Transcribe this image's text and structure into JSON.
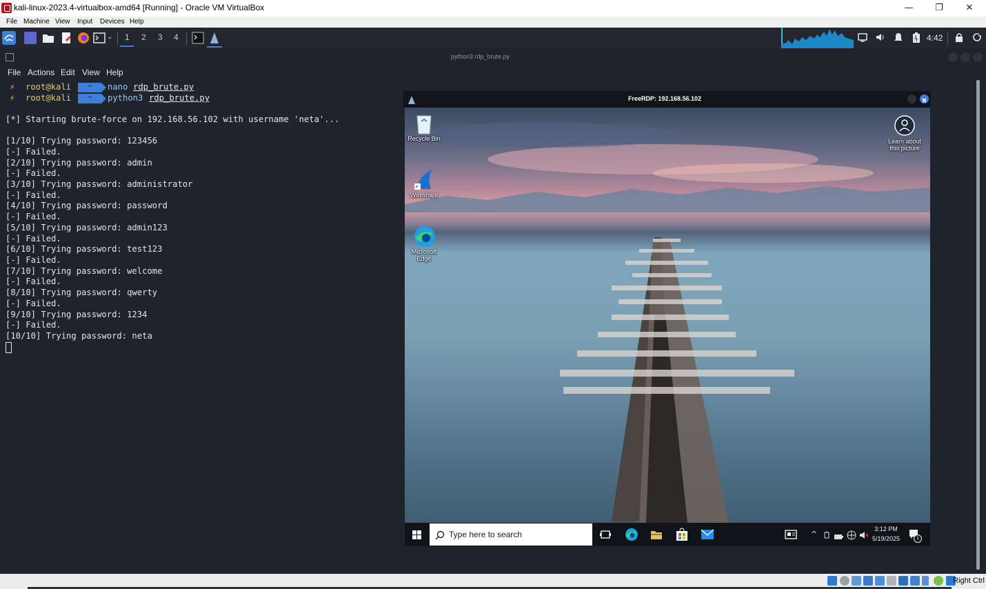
{
  "host_window": {
    "title": "kali-linux-2023.4-virtualbox-amd64 [Running] - Oracle VM VirtualBox",
    "menu": [
      "File",
      "Machine",
      "View",
      "Input",
      "Devices",
      "Help"
    ],
    "controls": {
      "minimize": "—",
      "restore": "❐",
      "close": "✕"
    }
  },
  "kali_panel": {
    "workspaces": [
      "1",
      "2",
      "3",
      "4"
    ],
    "clock": "4:42"
  },
  "terminal": {
    "window_title": "python3 rdp_brute.py",
    "menu": [
      "File",
      "Actions",
      "Edit",
      "View",
      "Help"
    ],
    "prompts": [
      {
        "bolt": "⚡",
        "user": "root@kali",
        "tilde": "~",
        "cmd": "nano",
        "arg": "rdp_brute.py"
      },
      {
        "bolt": "⚡",
        "user": "root@kali",
        "tilde": "~",
        "cmd": "python3",
        "arg": "rdp_brute.py"
      }
    ],
    "output": [
      "[*] Starting brute-force on 192.168.56.102 with username 'neta'...",
      "",
      "[1/10] Trying password: 123456",
      "[-] Failed.",
      "[2/10] Trying password: admin",
      "[-] Failed.",
      "[3/10] Trying password: administrator",
      "[-] Failed.",
      "[4/10] Trying password: password",
      "[-] Failed.",
      "[5/10] Trying password: admin123",
      "[-] Failed.",
      "[6/10] Trying password: test123",
      "[-] Failed.",
      "[7/10] Trying password: welcome",
      "[-] Failed.",
      "[8/10] Trying password: qwerty",
      "[-] Failed.",
      "[9/10] Trying password: 1234",
      "[-] Failed.",
      "[10/10] Trying password: neta"
    ]
  },
  "rdp_window": {
    "title": "FreeRDP: 192.168.56.102",
    "desktop_icons": {
      "recycle_bin": "Recycle Bin",
      "wireshark": "Wireshark",
      "edge_line1": "Microsoft",
      "edge_line2": "Edge",
      "learn_line1": "Learn about",
      "learn_line2": "this picture"
    },
    "taskbar": {
      "search_placeholder": "Type here to search",
      "time": "3:12 PM",
      "date": "5/19/2025",
      "notifications": "1"
    }
  },
  "status_bar": {
    "host_key": "Right Ctrl"
  },
  "colors": {
    "terminal_bg": "#1f232b",
    "prompt_accent": "#3d7fd9",
    "prompt_user": "#e6c85a",
    "rdp_close": "#3b7fe0"
  }
}
